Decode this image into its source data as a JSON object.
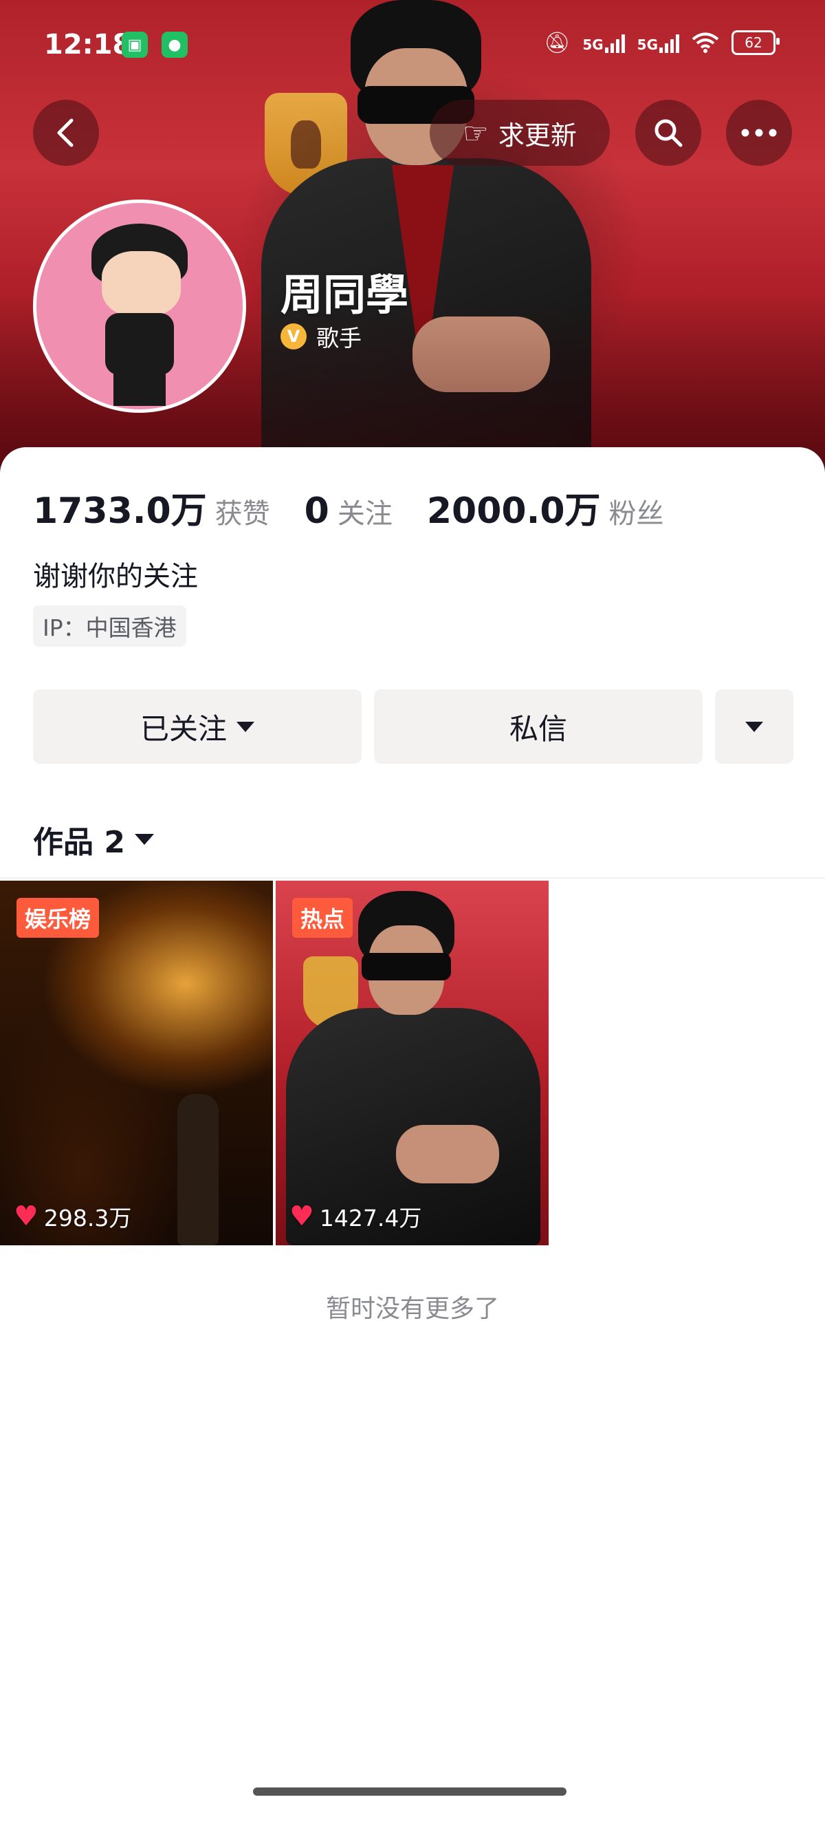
{
  "status_bar": {
    "time": "12:18",
    "net1": "5G",
    "net2": "5G",
    "battery": "62",
    "icons": [
      "mi-home-icon",
      "wechat-icon",
      "mute-bell-icon",
      "signal-icon",
      "wifi-icon",
      "battery-icon"
    ]
  },
  "header": {
    "request_update_label": "求更新",
    "back_icon": "chevron-left-icon",
    "search_icon": "search-icon",
    "more_icon": "more-icon"
  },
  "profile": {
    "name": "周同學",
    "verify_badge": "V",
    "role": "歌手",
    "bio": "谢谢你的关注",
    "ip": "IP：中国香港"
  },
  "stats": [
    {
      "num": "1733.0万",
      "label": "获赞"
    },
    {
      "num": "0",
      "label": "关注"
    },
    {
      "num": "2000.0万",
      "label": "粉丝"
    }
  ],
  "actions": {
    "following_label": "已关注",
    "message_label": "私信"
  },
  "works": {
    "tab_label": "作品 2",
    "items": [
      {
        "tag": "娱乐榜",
        "likes": "298.3万"
      },
      {
        "tag": "热点",
        "likes": "1427.4万"
      }
    ],
    "end_text": "暂时没有更多了"
  },
  "colors": {
    "accent_red": "#b0222a",
    "tag_orange": "#fe5a3c",
    "heart": "#ff2c55"
  }
}
